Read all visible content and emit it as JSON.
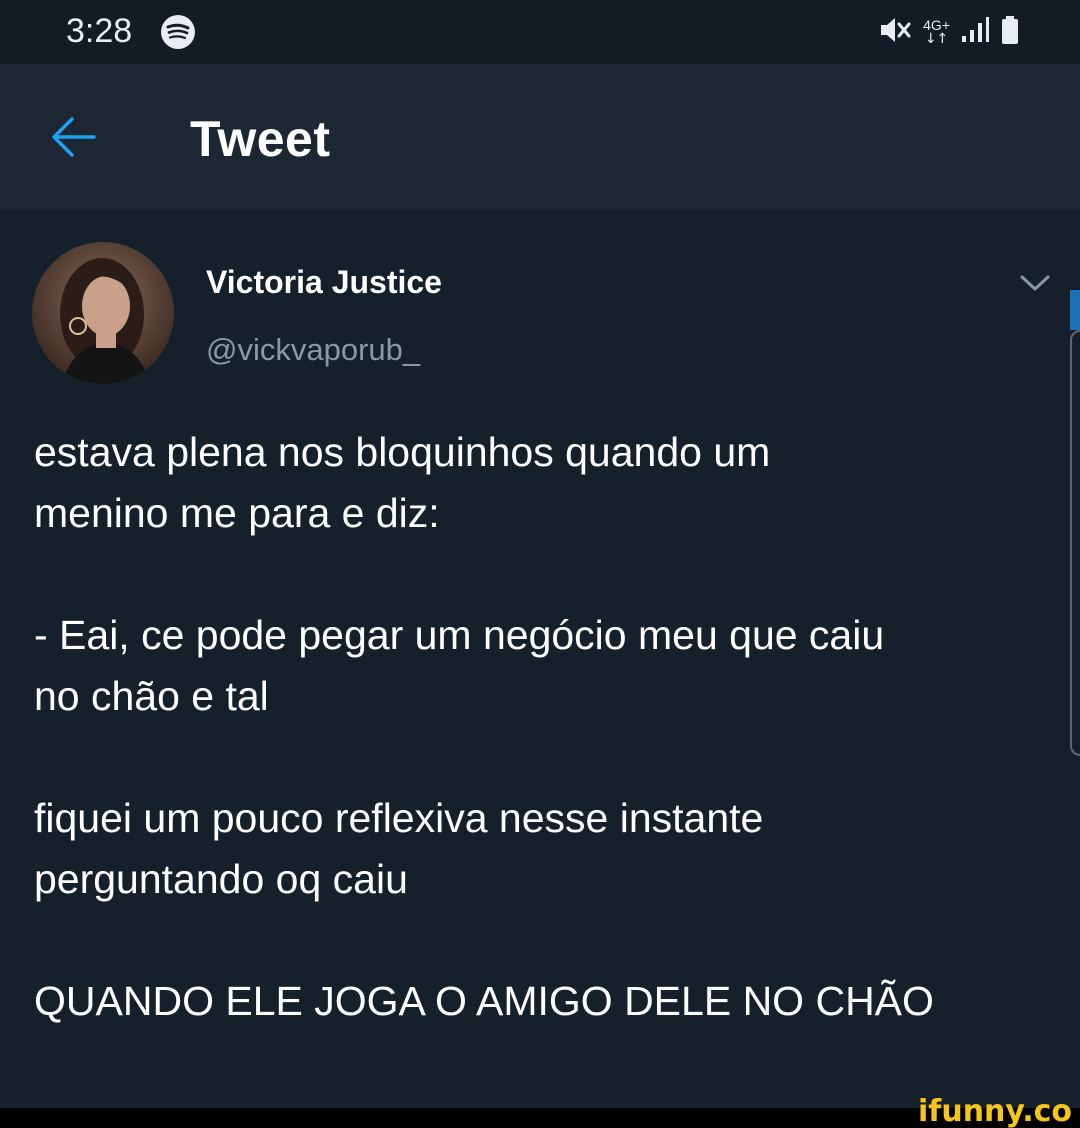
{
  "status_bar": {
    "time": "3:28",
    "icons": [
      "spotify-icon",
      "mute-icon",
      "network-4g-icon",
      "signal-icon",
      "battery-icon"
    ],
    "network_label": "4G+"
  },
  "header": {
    "title": "Tweet",
    "back_icon": "arrow-left-icon",
    "accent_color": "#1da1f2"
  },
  "tweet": {
    "author_name": "Victoria Justice",
    "author_handle": "@vickvaporub_",
    "menu_icon": "chevron-down-icon",
    "paragraphs": [
      "estava plena nos bloquinhos quando um\nmenino me para e diz:",
      "- Eai, ce pode pegar um negócio meu que caiu\nno chão e tal",
      "fiquei um pouco reflexiva nesse instante\nperguntando oq caiu",
      "QUANDO ELE JOGA O AMIGO DELE NO CHÃO"
    ]
  },
  "watermark": {
    "text": "ifunny.co"
  },
  "colors": {
    "background": "#16202b",
    "header": "#1c2733",
    "text": "#ffffff",
    "secondary_text": "#8899a6",
    "watermark": "#f5c518"
  }
}
